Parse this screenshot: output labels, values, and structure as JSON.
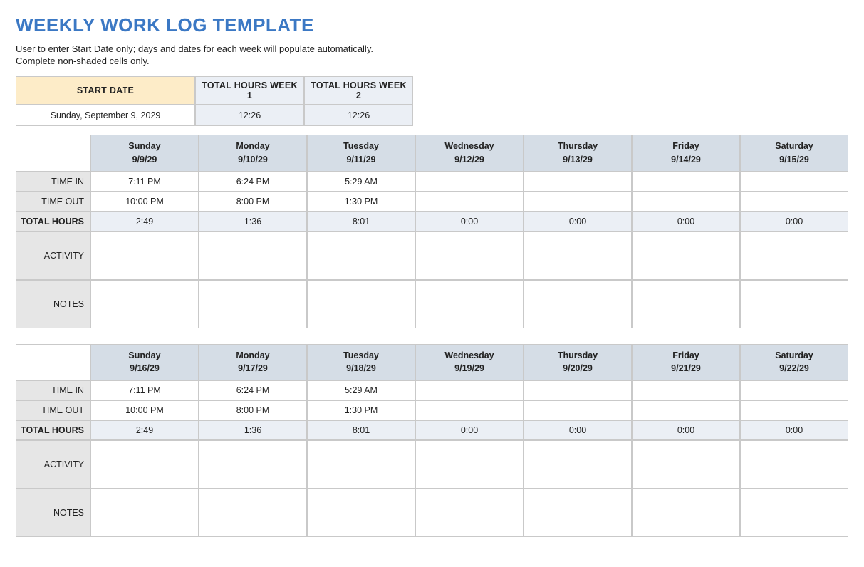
{
  "title": "WEEKLY WORK LOG TEMPLATE",
  "instructions": [
    "User to enter Start Date only; days and dates for each week will populate automatically.",
    "Complete non-shaded cells only."
  ],
  "summary": {
    "start_date_label": "START DATE",
    "total_week1_label": "TOTAL HOURS WEEK 1",
    "total_week2_label": "TOTAL HOURS WEEK 2",
    "start_date_value": "Sunday, September 9, 2029",
    "total_week1_value": "12:26",
    "total_week2_value": "12:26"
  },
  "row_labels": {
    "time_in": "TIME IN",
    "time_out": "TIME OUT",
    "total_hours": "TOTAL HOURS",
    "activity": "ACTIVITY",
    "notes": "NOTES"
  },
  "weeks": [
    {
      "days": [
        {
          "name": "Sunday",
          "date": "9/9/29",
          "time_in": "7:11 PM",
          "time_out": "10:00 PM",
          "total": "2:49",
          "activity": "",
          "notes": ""
        },
        {
          "name": "Monday",
          "date": "9/10/29",
          "time_in": "6:24 PM",
          "time_out": "8:00 PM",
          "total": "1:36",
          "activity": "",
          "notes": ""
        },
        {
          "name": "Tuesday",
          "date": "9/11/29",
          "time_in": "5:29 AM",
          "time_out": "1:30 PM",
          "total": "8:01",
          "activity": "",
          "notes": ""
        },
        {
          "name": "Wednesday",
          "date": "9/12/29",
          "time_in": "",
          "time_out": "",
          "total": "0:00",
          "activity": "",
          "notes": ""
        },
        {
          "name": "Thursday",
          "date": "9/13/29",
          "time_in": "",
          "time_out": "",
          "total": "0:00",
          "activity": "",
          "notes": ""
        },
        {
          "name": "Friday",
          "date": "9/14/29",
          "time_in": "",
          "time_out": "",
          "total": "0:00",
          "activity": "",
          "notes": ""
        },
        {
          "name": "Saturday",
          "date": "9/15/29",
          "time_in": "",
          "time_out": "",
          "total": "0:00",
          "activity": "",
          "notes": ""
        }
      ]
    },
    {
      "days": [
        {
          "name": "Sunday",
          "date": "9/16/29",
          "time_in": "7:11 PM",
          "time_out": "10:00 PM",
          "total": "2:49",
          "activity": "",
          "notes": ""
        },
        {
          "name": "Monday",
          "date": "9/17/29",
          "time_in": "6:24 PM",
          "time_out": "8:00 PM",
          "total": "1:36",
          "activity": "",
          "notes": ""
        },
        {
          "name": "Tuesday",
          "date": "9/18/29",
          "time_in": "5:29 AM",
          "time_out": "1:30 PM",
          "total": "8:01",
          "activity": "",
          "notes": ""
        },
        {
          "name": "Wednesday",
          "date": "9/19/29",
          "time_in": "",
          "time_out": "",
          "total": "0:00",
          "activity": "",
          "notes": ""
        },
        {
          "name": "Thursday",
          "date": "9/20/29",
          "time_in": "",
          "time_out": "",
          "total": "0:00",
          "activity": "",
          "notes": ""
        },
        {
          "name": "Friday",
          "date": "9/21/29",
          "time_in": "",
          "time_out": "",
          "total": "0:00",
          "activity": "",
          "notes": ""
        },
        {
          "name": "Saturday",
          "date": "9/22/29",
          "time_in": "",
          "time_out": "",
          "total": "0:00",
          "activity": "",
          "notes": ""
        }
      ]
    }
  ]
}
